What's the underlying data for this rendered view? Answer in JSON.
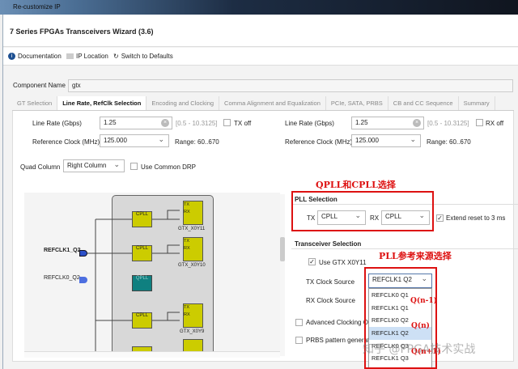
{
  "window": {
    "title": "Re-customize IP"
  },
  "header": {
    "title": "7 Series FPGAs Transceivers Wizard (3.6)"
  },
  "toolbar": {
    "documentation": "Documentation",
    "ip_location": "IP Location",
    "switch_defaults": "Switch to Defaults"
  },
  "component": {
    "label": "Component Name",
    "value": "gtx"
  },
  "tabs": [
    "GT Selection",
    "Line Rate, RefClk Selection",
    "Encoding and Clocking",
    "Comma Alignment and Equalization",
    "PCIe, SATA, PRBS",
    "CB and CC Sequence",
    "Summary"
  ],
  "tx": {
    "line_rate_label": "Line Rate (Gbps)",
    "line_rate": "1.25",
    "range": "[0.5 - 10.3125]",
    "off_label": "TX off",
    "refclk_label": "Reference Clock (MHz)",
    "refclk": "125.000",
    "refclk_range": "Range: 60..670"
  },
  "rx": {
    "line_rate_label": "Line Rate (Gbps)",
    "line_rate": "1.25",
    "range": "[0.5 - 10.3125]",
    "off_label": "RX off",
    "refclk_label": "Reference Clock (MHz)",
    "refclk": "125.000",
    "refclk_range": "Range: 60..670"
  },
  "quad": {
    "label": "Quad Column",
    "value": "Right Column",
    "common_drp": "Use Common DRP"
  },
  "diagram": {
    "refclk1": "REFCLK1_Q2",
    "refclk0": "REFCLK0_Q2",
    "cpll": "CPLL",
    "qpll": "QPLL",
    "tx": "TX",
    "rx": "RX",
    "gtx": [
      "GTX_X0Y11",
      "GTX_X0Y10",
      "GTX_X0Y9"
    ]
  },
  "pll": {
    "title": "PLL Selection",
    "tx_label": "TX",
    "tx_value": "CPLL",
    "rx_label": "RX",
    "rx_value": "CPLL",
    "extend_reset": "Extend reset to 3 ms"
  },
  "transceiver": {
    "title": "Transceiver Selection",
    "use_gtx": "Use GTX X0Y11",
    "tx_clock_label": "TX Clock Source",
    "tx_clock_value": "REFCLK1 Q2",
    "rx_clock_label": "RX Clock Source",
    "advanced": "Advanced Clocking Op",
    "prbs": "PRBS pattern generat"
  },
  "dropdown": [
    "REFCLK0 Q1",
    "REFCLK1 Q1",
    "REFCLK0 Q2",
    "REFCLK1 Q2",
    "REFCLK0 Q3",
    "REFCLK1 Q3"
  ],
  "annotations": {
    "pll_note": "QPLL和CPLL选择",
    "ref_note": "PLL参考来源选择",
    "q_minus": "Q(n-1)",
    "q_n": "Q(n)",
    "q_plus": "Q(n+1)",
    "watermark": "知乎 @FPGA技术实战"
  }
}
